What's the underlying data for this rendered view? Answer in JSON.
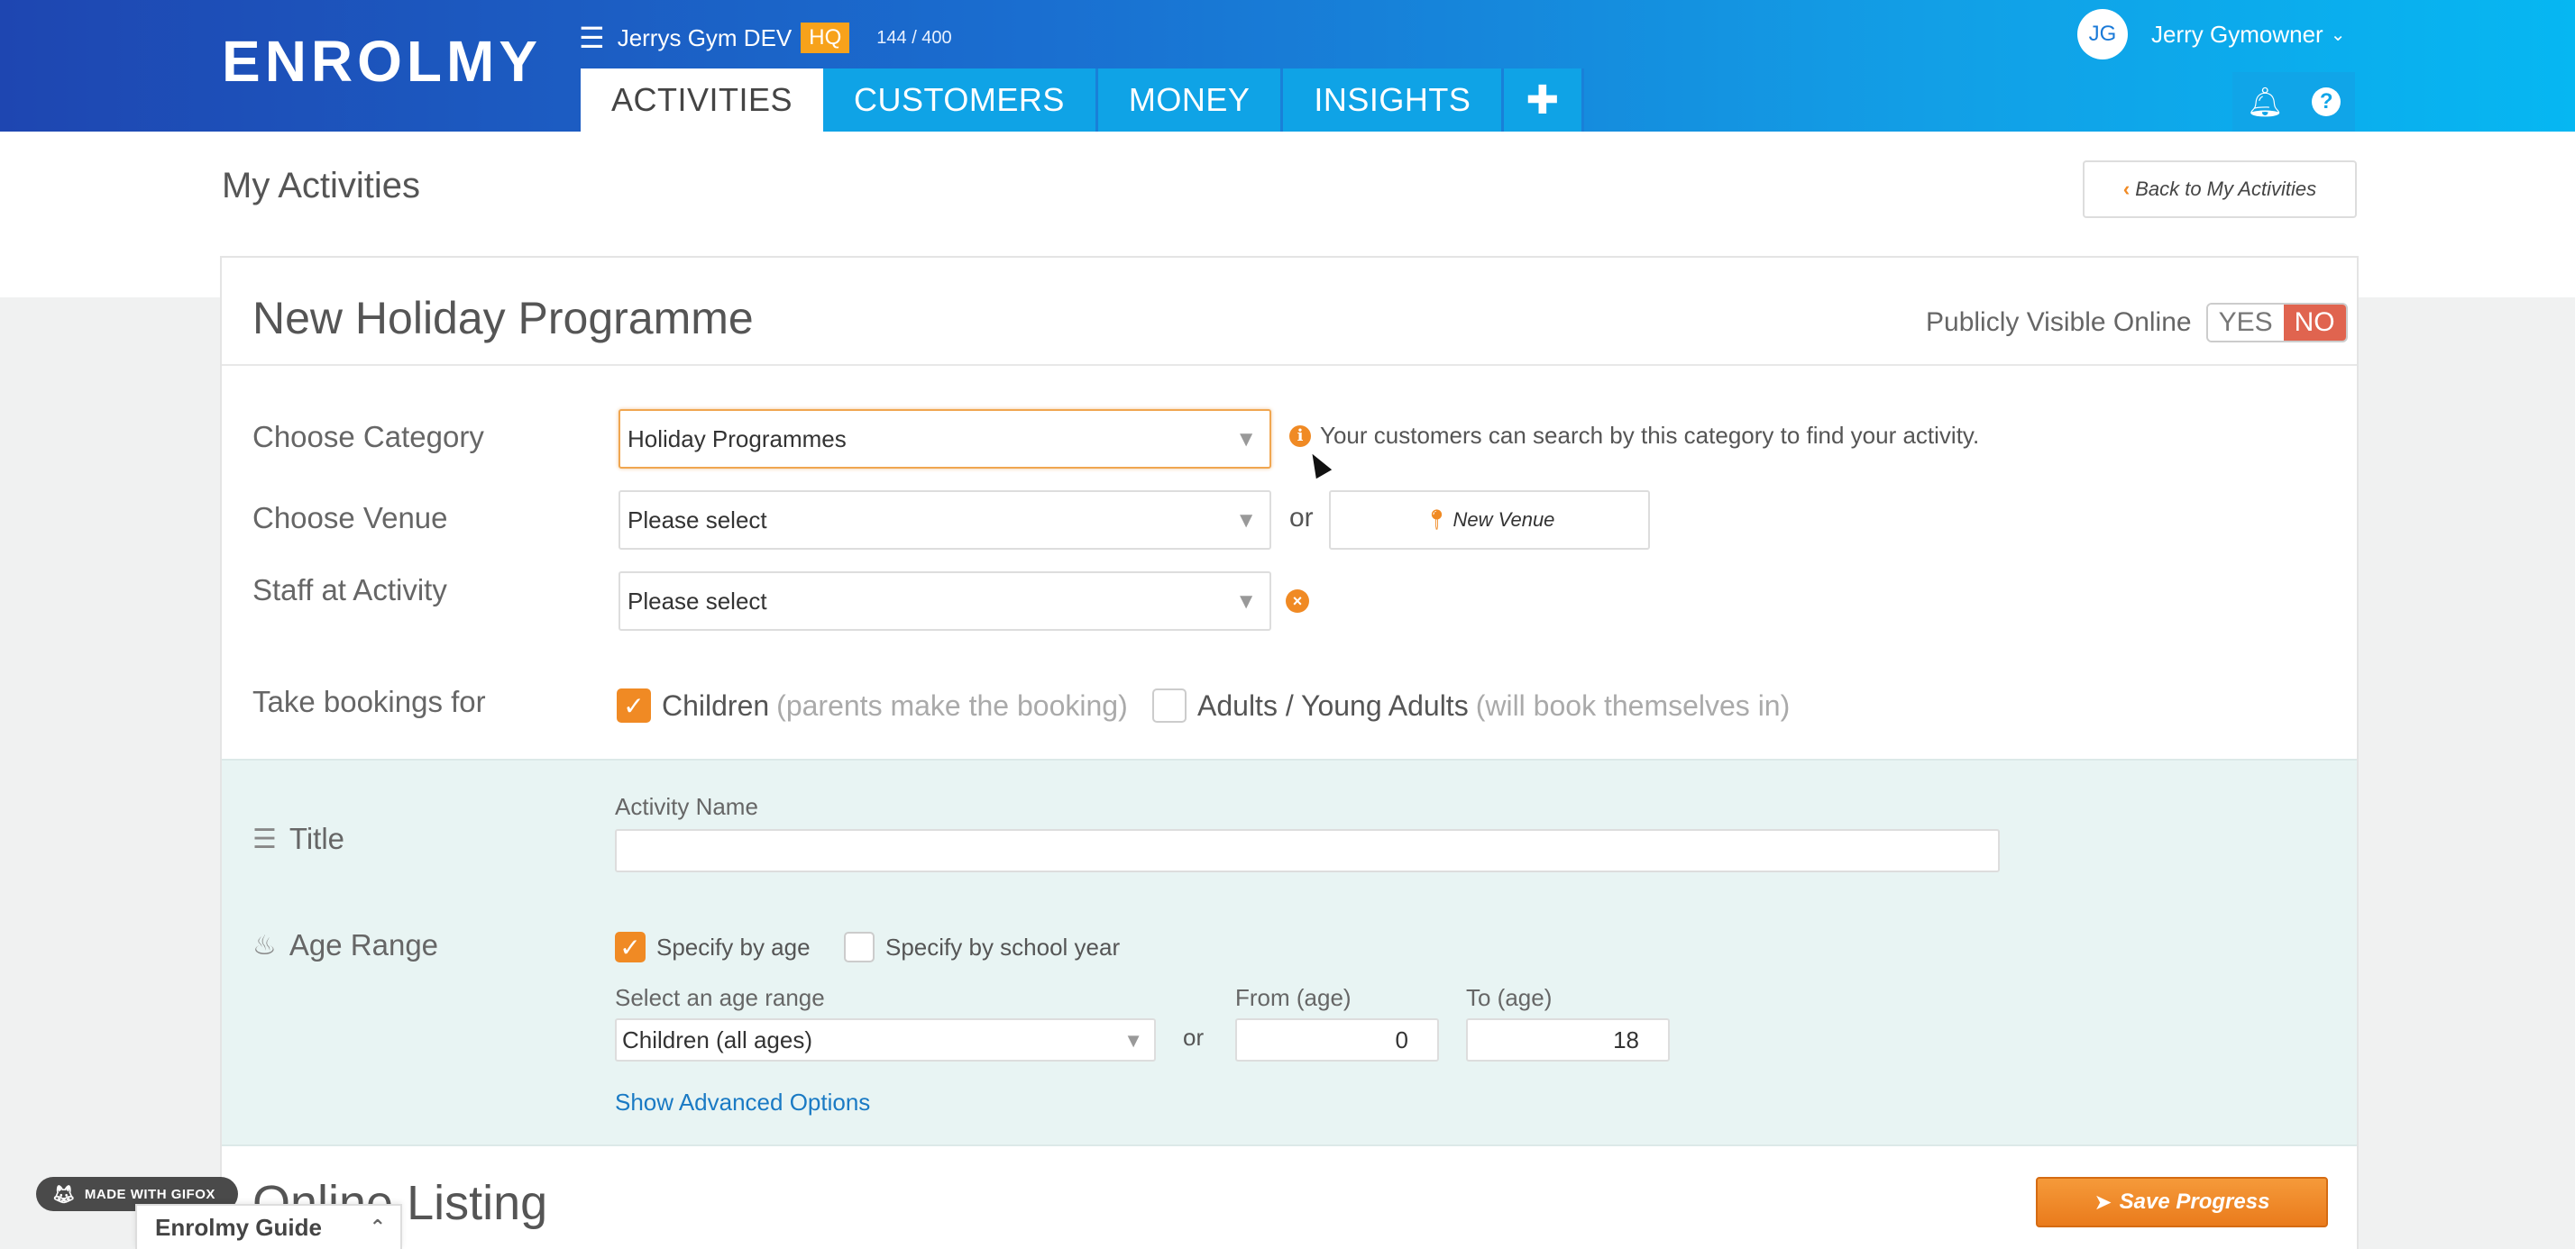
{
  "app": {
    "logo_text": "ENROLMY",
    "org_name": "Jerrys Gym DEV",
    "org_badge": "HQ",
    "quota": "144 / 400",
    "brand_gradient": [
      "#1e46b1",
      "#06b7f2"
    ],
    "accent": "#f08a24"
  },
  "nav": {
    "tabs": [
      {
        "label": "ACTIVITIES",
        "active": true
      },
      {
        "label": "CUSTOMERS",
        "active": false
      },
      {
        "label": "MONEY",
        "active": false
      },
      {
        "label": "INSIGHTS",
        "active": false
      }
    ],
    "plus": "✚",
    "icons": [
      "menu-icon",
      "bell-icon",
      "help-icon",
      "plus-icon"
    ]
  },
  "user": {
    "initials": "JG",
    "name": "Jerry Gymowner"
  },
  "page": {
    "title": "My Activities",
    "back_label": "Back to My Activities"
  },
  "form": {
    "title": "New Holiday Programme",
    "visible_label": "Publicly Visible Online",
    "visible_yes": "YES",
    "visible_no": "NO",
    "visible_value": "NO",
    "category_label": "Choose Category",
    "category_value": "Holiday Programmes",
    "category_info": "Your customers can search by this category to find your activity.",
    "venue_label": "Choose Venue",
    "venue_value": "Please select",
    "or": "or",
    "new_venue": "New Venue",
    "staff_label": "Staff at Activity",
    "staff_value": "Please select",
    "bookings_label": "Take bookings for",
    "children_label": "Children",
    "children_sub": "(parents make the booking)",
    "children_checked": true,
    "adults_label": "Adults / Young Adults",
    "adults_sub": "(will book themselves in)",
    "adults_checked": false
  },
  "details": {
    "title_label": "Title",
    "activity_name_label": "Activity Name",
    "activity_name_value": "",
    "age_label": "Age Range",
    "by_age_label": "Specify by age",
    "by_age_checked": true,
    "by_school_label": "Specify by school year",
    "by_school_checked": false,
    "age_range_label": "Select an age range",
    "age_range_value": "Children (all ages)",
    "or": "or",
    "from_label": "From (age)",
    "from_value": "0",
    "to_label": "To (age)",
    "to_value": "18",
    "advanced_link": "Show Advanced Options"
  },
  "listing": {
    "title": "Online Listing",
    "save_label": "Save Progress"
  },
  "overlays": {
    "gifox_label": "MADE WITH GIFOX",
    "guide_label": "Enrolmy Guide"
  }
}
